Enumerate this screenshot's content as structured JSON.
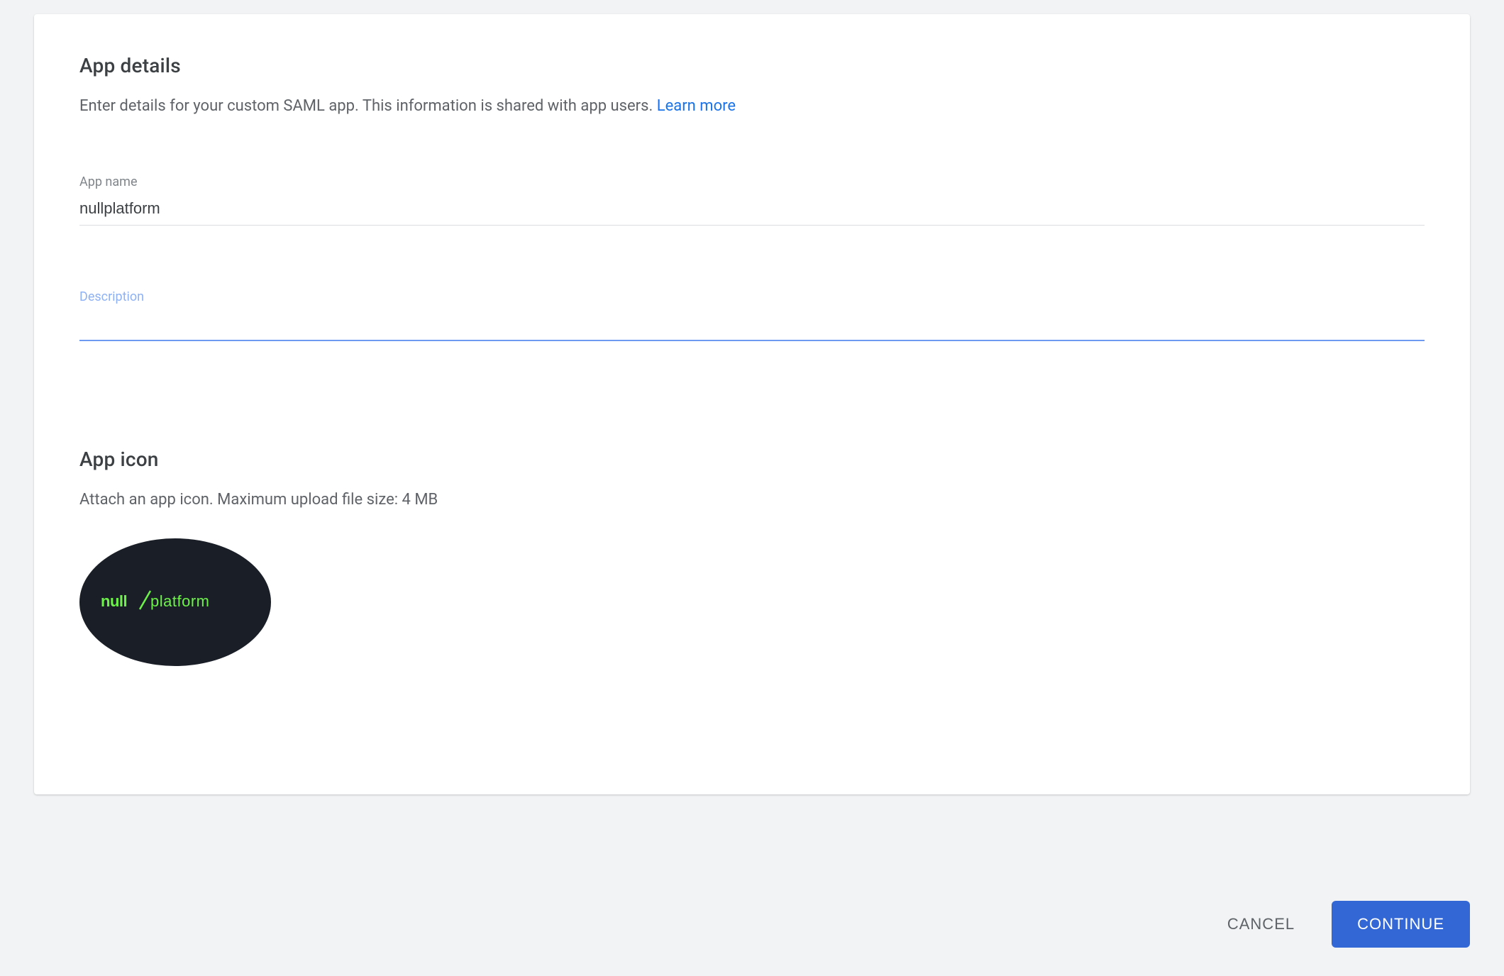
{
  "app_details": {
    "title": "App details",
    "subtitle": "Enter details for your custom SAML app. This information is shared with app users. ",
    "learn_more": "Learn more"
  },
  "form": {
    "app_name_label": "App name",
    "app_name_value": "nullplatform",
    "description_label": "Description",
    "description_value": ""
  },
  "app_icon": {
    "title": "App icon",
    "subtitle": "Attach an app icon. Maximum upload file size: 4 MB",
    "logo_text_left": "null",
    "logo_text_right": "platform",
    "logo_bg_color": "#1a1f27",
    "logo_text_color": "#6df24a"
  },
  "actions": {
    "cancel": "CANCEL",
    "continue": "CONTINUE"
  }
}
